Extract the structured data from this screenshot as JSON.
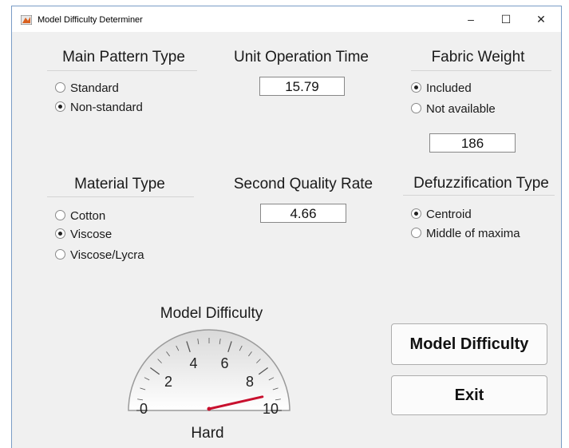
{
  "window": {
    "title": "Model Difficulty Determiner",
    "minimize": "–",
    "maximize": "☐",
    "close": "✕"
  },
  "main_pattern": {
    "title": "Main Pattern Type",
    "options": [
      "Standard",
      "Non-standard"
    ],
    "selected": "Non-standard"
  },
  "unit_operation_time": {
    "title": "Unit Operation Time",
    "value": "15.79"
  },
  "fabric_weight": {
    "title": "Fabric Weight",
    "options": [
      "Included",
      "Not available"
    ],
    "selected": "Included",
    "value": "186"
  },
  "material_type": {
    "title": "Material Type",
    "options": [
      "Cotton",
      "Viscose",
      "Viscose/Lycra"
    ],
    "selected": "Viscose"
  },
  "second_quality_rate": {
    "title": "Second Quality Rate",
    "value": "4.66"
  },
  "defuzzification": {
    "title": "Defuzzification Type",
    "options": [
      "Centroid",
      "Middle of maxima"
    ],
    "selected": "Centroid"
  },
  "gauge": {
    "title": "Model Difficulty",
    "tick_labels": [
      "0",
      "2",
      "4",
      "6",
      "8",
      "10"
    ],
    "min": 0,
    "max": 10,
    "value": 9.2,
    "needle_color": "#c8102e",
    "result": "Hard"
  },
  "buttons": {
    "model_difficulty": "Model Difficulty",
    "exit": "Exit"
  }
}
